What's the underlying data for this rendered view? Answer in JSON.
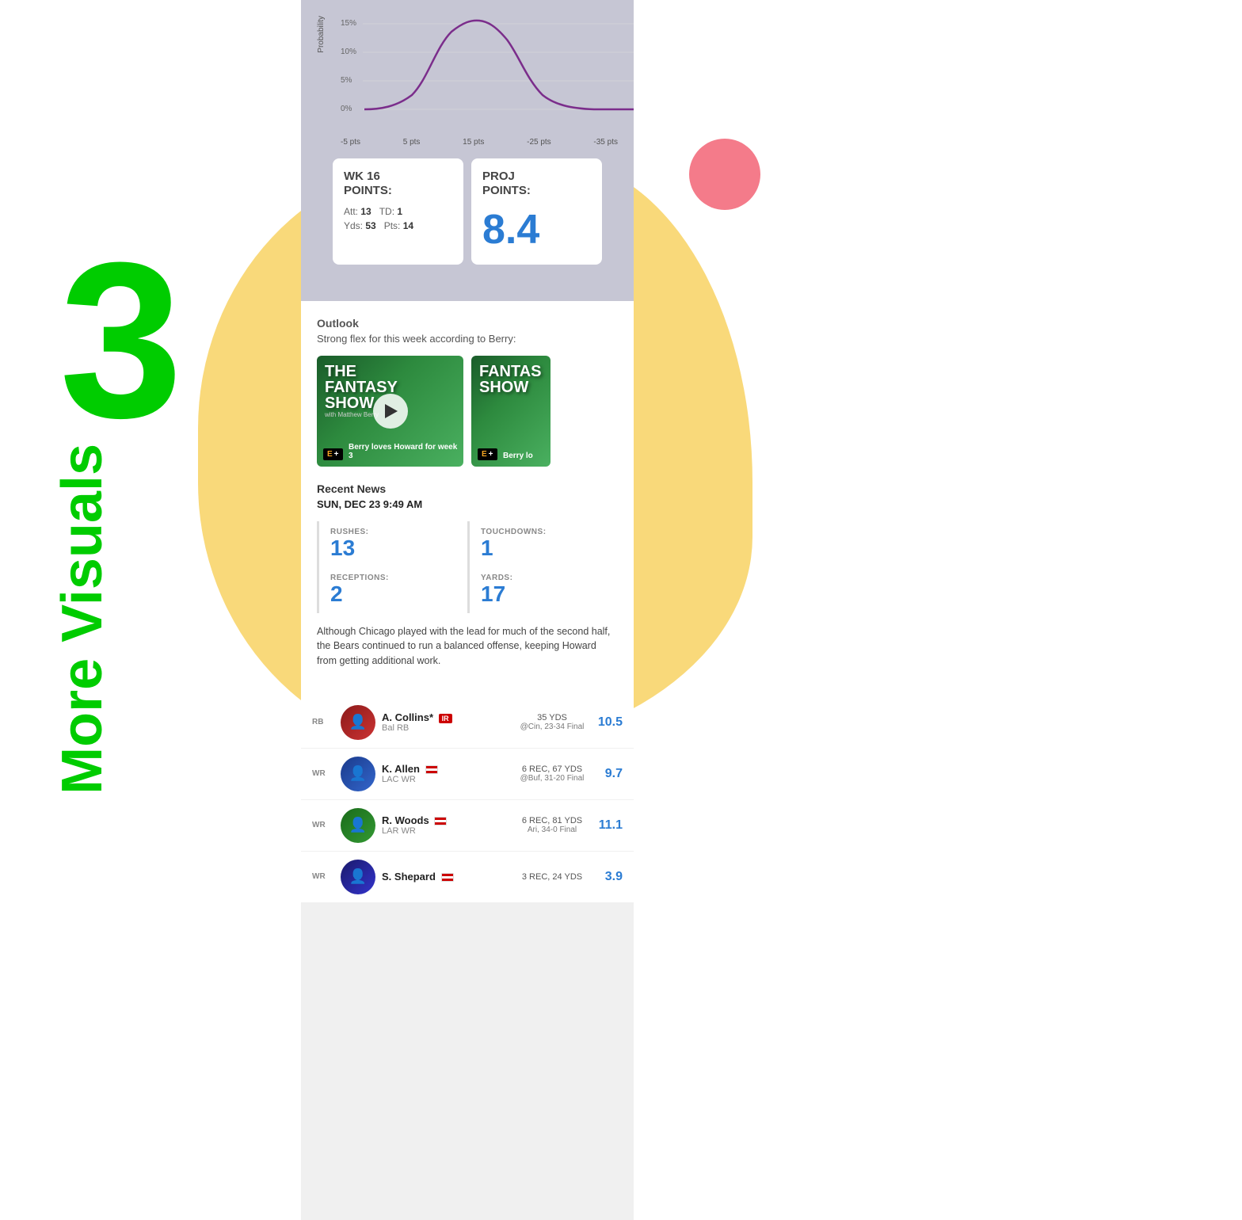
{
  "background": {
    "blob_color": "#F9D97A",
    "circle_color": "#F47B8A"
  },
  "big_number": "3",
  "more_visuals_label": "More Visuals",
  "chart": {
    "y_label": "Probability",
    "y_values": [
      "15%",
      "10%",
      "5%",
      "0%"
    ],
    "x_labels": [
      "-5 pts",
      "5 pts",
      "15 pts",
      "-25 pts",
      "-35 pts"
    ]
  },
  "wk_box": {
    "title": "WK 16\nPOINTS:",
    "att_label": "Att:",
    "att_value": "13",
    "td_label": "TD:",
    "td_value": "1",
    "yds_label": "Yds:",
    "yds_value": "53",
    "pts_label": "Pts:",
    "pts_value": "14"
  },
  "proj_box": {
    "title": "PROJ\nPOINTS:",
    "value": "8.4"
  },
  "outlook": {
    "title": "Outlook",
    "description": "Strong flex for this week according to Berry:"
  },
  "videos": [
    {
      "show": "FANTASY\nSHOW",
      "caption": "Berry loves Howard for week 3",
      "badge": "E+"
    },
    {
      "show": "FANTAS\nSHOW",
      "caption": "Berry lo",
      "badge": "E+"
    }
  ],
  "recent_news": {
    "title": "Recent News",
    "date": "SUN, DEC 23 9:49 AM",
    "stats": [
      {
        "label": "RUSHES:",
        "value": "13"
      },
      {
        "label": "TOUCHDOWNS:",
        "value": "1"
      },
      {
        "label": "RECEPTIONS:",
        "value": "2"
      },
      {
        "label": "YARDS:",
        "value": "17"
      }
    ],
    "body": "Although Chicago played with the lead for much of the second half, the Bears continued to run a balanced offense, keeping Howard from getting additional work."
  },
  "players": [
    {
      "position": "RB",
      "name": "A. Collins*",
      "team": "Bal RB",
      "badge": "IR",
      "stats": "35 YDS",
      "game": "@Cin, 23-34 Final",
      "points": "10.5"
    },
    {
      "position": "WR",
      "name": "K. Allen",
      "team": "LAC WR",
      "badge": "flag",
      "stats": "6 REC, 67 YDS",
      "game": "@Buf, 31-20 Final",
      "points": "9.7"
    },
    {
      "position": "WR",
      "name": "R. Woods",
      "team": "LAR WR",
      "badge": "flag",
      "stats": "6 REC, 81 YDS",
      "game": "Ari, 34-0 Final",
      "points": "11.1"
    },
    {
      "position": "WR",
      "name": "S. Shepard",
      "team": "",
      "badge": "flag",
      "stats": "3 REC, 24 YDS",
      "game": "",
      "points": "3.9"
    }
  ]
}
